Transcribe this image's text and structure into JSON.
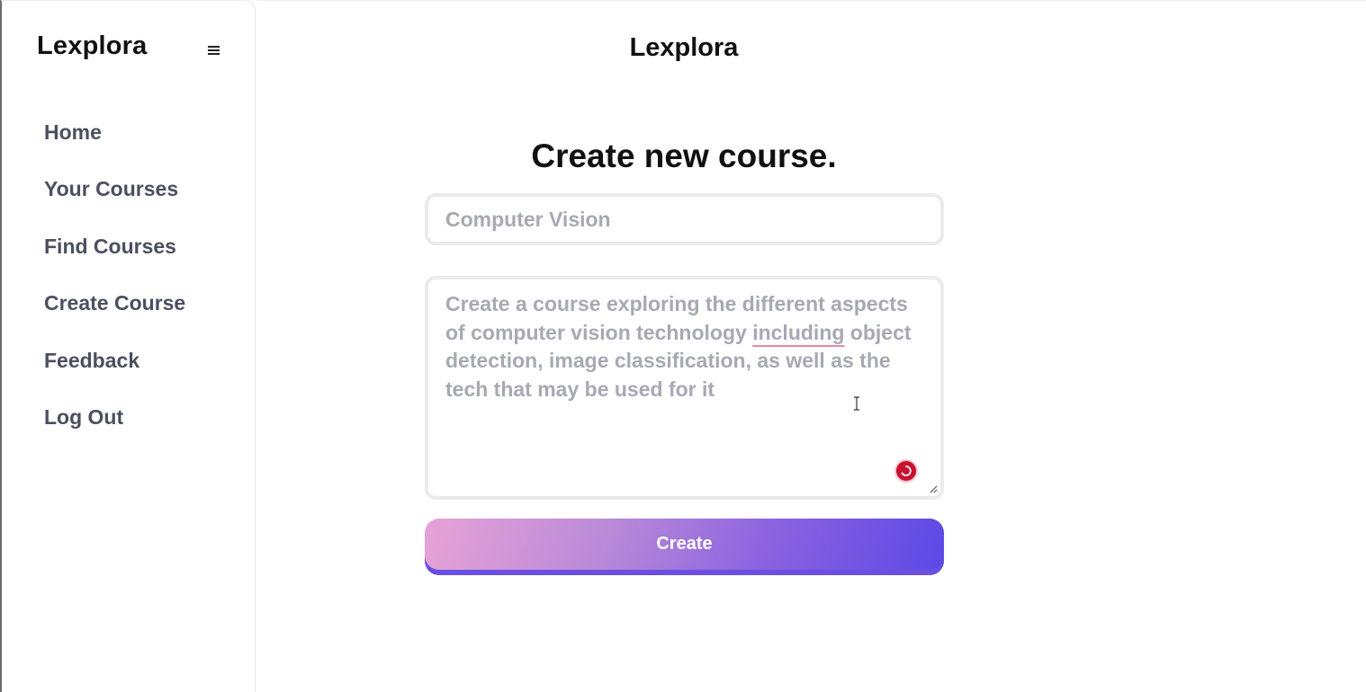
{
  "sidebar": {
    "brand": "Lexplora",
    "menu_icon": "hamburger-icon",
    "items": [
      {
        "label": "Home"
      },
      {
        "label": "Your Courses"
      },
      {
        "label": "Find Courses"
      },
      {
        "label": "Create Course"
      },
      {
        "label": "Feedback"
      },
      {
        "label": "Log Out"
      }
    ]
  },
  "header": {
    "title": "Lexplora"
  },
  "form": {
    "heading": "Create new course.",
    "title_placeholder": "Computer Vision",
    "description": {
      "before_underline": "Create a course exploring the different aspects of computer vision technology ",
      "underlined_word": "including",
      "after_underline": " object detection, image classification, as well as the tech that may be used for it"
    },
    "submit_label": "Create"
  },
  "colors": {
    "button_gradient_start": "#e8a3d6",
    "button_gradient_end": "#5b48e6",
    "grammar_badge": "#c8102e",
    "placeholder_text": "#a7a9b3",
    "nav_text": "#4b5060"
  }
}
